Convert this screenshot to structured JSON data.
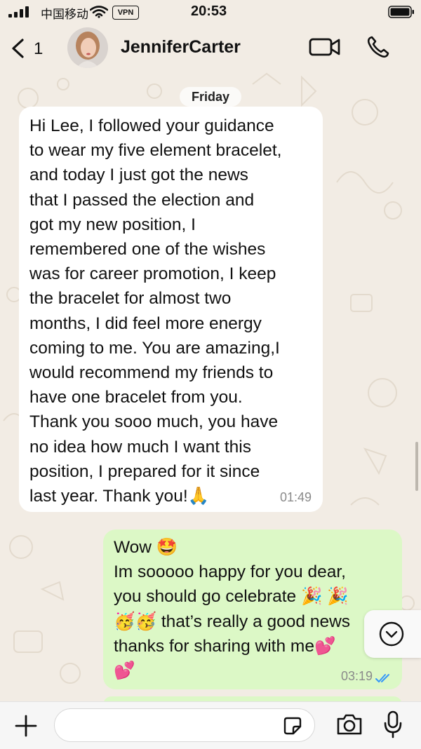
{
  "status_bar": {
    "carrier": "中国移动",
    "vpn": "VPN",
    "time": "20:53"
  },
  "header": {
    "back_count": "1",
    "contact_name": "JenniferCarter"
  },
  "chat": {
    "day_label": "Friday",
    "messages": [
      {
        "direction": "incoming",
        "text": "Hi Lee, I followed your guidance\nto wear my five element bracelet,\nand today I just got the news\nthat I passed the election and\ngot my new position, I\nremembered one of the wishes\nwas for career promotion, I keep\nthe bracelet for almost two\nmonths, I did feel more energy\ncoming to me. You are amazing,I\nwould recommend my friends to\nhave one bracelet from you.\nThank you sooo much, you have\nno idea how much I want this\nposition, I prepared for it since\nlast year. Thank you!🙏",
        "time": "01:49"
      },
      {
        "direction": "outgoing",
        "text": "Wow 🤩\nIm sooooo happy for you dear,\nyou should go celebrate 🎉 🎉\n🥳🥳 that’s really a good news\nthanks for sharing with me💕\n💕",
        "time": "03:19",
        "status": "read"
      }
    ]
  },
  "composer": {
    "placeholder": ""
  },
  "colors": {
    "background": "#f2ece4",
    "incoming_bubble": "#ffffff",
    "outgoing_bubble": "#dcf8c6",
    "read_ticks": "#3497f9"
  }
}
